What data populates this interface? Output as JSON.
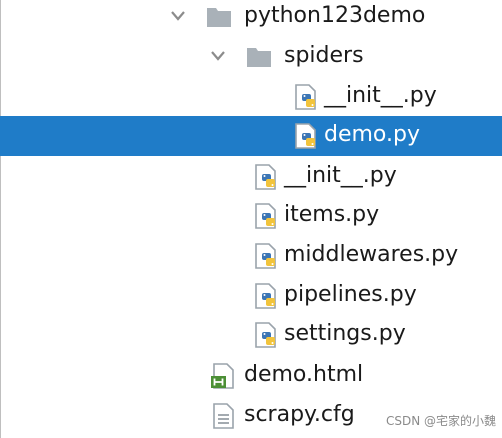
{
  "project_tree": {
    "items": [
      {
        "label": "python123demo",
        "icon": "folder-icon",
        "expanded": true
      },
      {
        "label": "spiders",
        "icon": "folder-icon",
        "expanded": true
      },
      {
        "label": "__init__.py",
        "icon": "python-file-icon"
      },
      {
        "label": "demo.py",
        "icon": "python-file-icon",
        "selected": true
      },
      {
        "label": "__init__.py",
        "icon": "python-file-icon"
      },
      {
        "label": "items.py",
        "icon": "python-file-icon"
      },
      {
        "label": "middlewares.py",
        "icon": "python-file-icon"
      },
      {
        "label": "pipelines.py",
        "icon": "python-file-icon"
      },
      {
        "label": "settings.py",
        "icon": "python-file-icon"
      },
      {
        "label": "demo.html",
        "icon": "html-file-icon"
      },
      {
        "label": "scrapy.cfg",
        "icon": "config-file-icon"
      }
    ],
    "selection_color": "#1f7cc8",
    "folder_color": "#a9b1b8",
    "python_blue": "#3c76b5",
    "python_yellow": "#f2c43c",
    "html_green": "#4c8f36"
  },
  "watermark": "CSDN @宅家的小魏"
}
